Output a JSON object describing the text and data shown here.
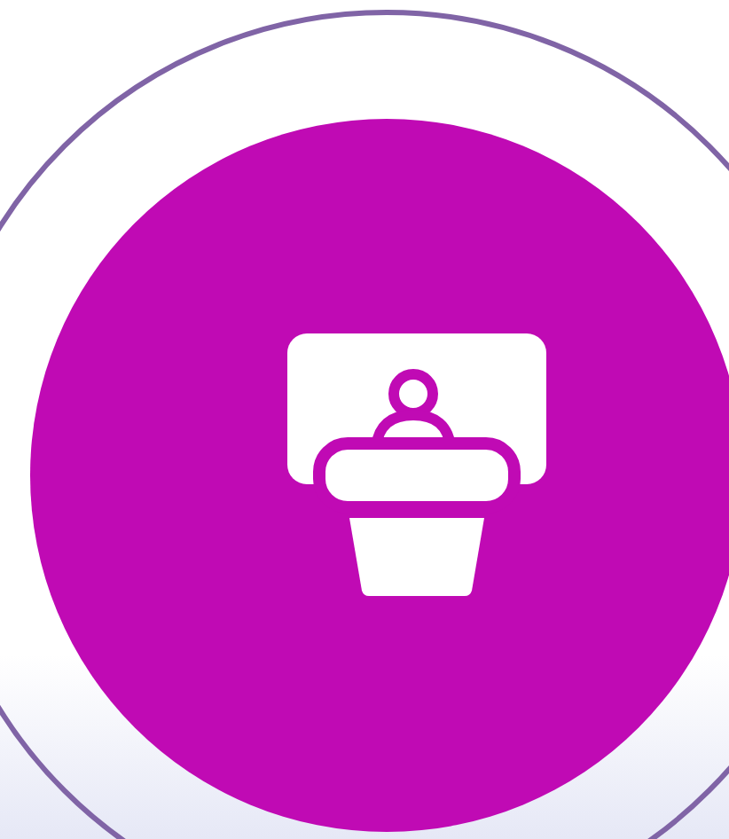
{
  "badge": {
    "kind": "presenter"
  }
}
